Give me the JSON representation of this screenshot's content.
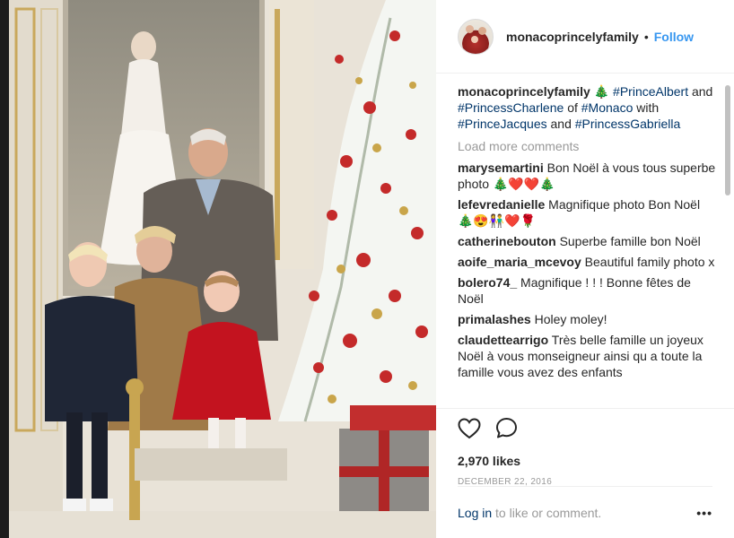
{
  "post": {
    "username": "monacoprincelyfamily",
    "separator": "•",
    "follow_label": "Follow",
    "caption_user": "monacoprincelyfamily",
    "caption_emoji": "🎄",
    "caption_parts": {
      "tag1": "#PrinceAlbert",
      "and1": "and",
      "tag2": "#PrincessCharlene",
      "of": "of",
      "tag3": "#Monaco",
      "with": "with",
      "tag4": "#PrinceJacques",
      "and2": "and",
      "tag5": "#PrincessGabriella"
    },
    "load_more": "Load more comments",
    "comments": [
      {
        "user": "marysemartini",
        "text": "Bon Noël à vous tous superbe photo",
        "emoji": "🎄❤️❤️🎄"
      },
      {
        "user": "lefevredanielle",
        "text": "Magnifique photo Bon Noël",
        "emoji": "🎄😍👫❤️🌹"
      },
      {
        "user": "catherinebouton",
        "text": "Superbe famille bon Noël",
        "emoji": ""
      },
      {
        "user": "aoife_maria_mcevoy",
        "text": "Beautiful family photo x",
        "emoji": ""
      },
      {
        "user": "bolero74_",
        "text": "Magnifique ! ! ! Bonne fêtes de Noël",
        "emoji": ""
      },
      {
        "user": "primalashes",
        "text": "Holey moley!",
        "emoji": ""
      },
      {
        "user": "claudettearrigo",
        "text": "Très belle famille un joyeux Noël à vous monseigneur ainsi qu a toute la famille vous avez des enfants",
        "emoji": ""
      }
    ],
    "likes": "2,970 likes",
    "date": "DECEMBER 22, 2016",
    "login_link": "Log in",
    "login_suffix": "to like or comment.",
    "more_options": "•••"
  },
  "icons": {
    "like": "heart-icon",
    "comment": "comment-bubble-icon",
    "options": "ellipsis-icon"
  },
  "colors": {
    "link": "#003569",
    "follow": "#3897f0",
    "muted": "#999999",
    "text": "#262626"
  }
}
